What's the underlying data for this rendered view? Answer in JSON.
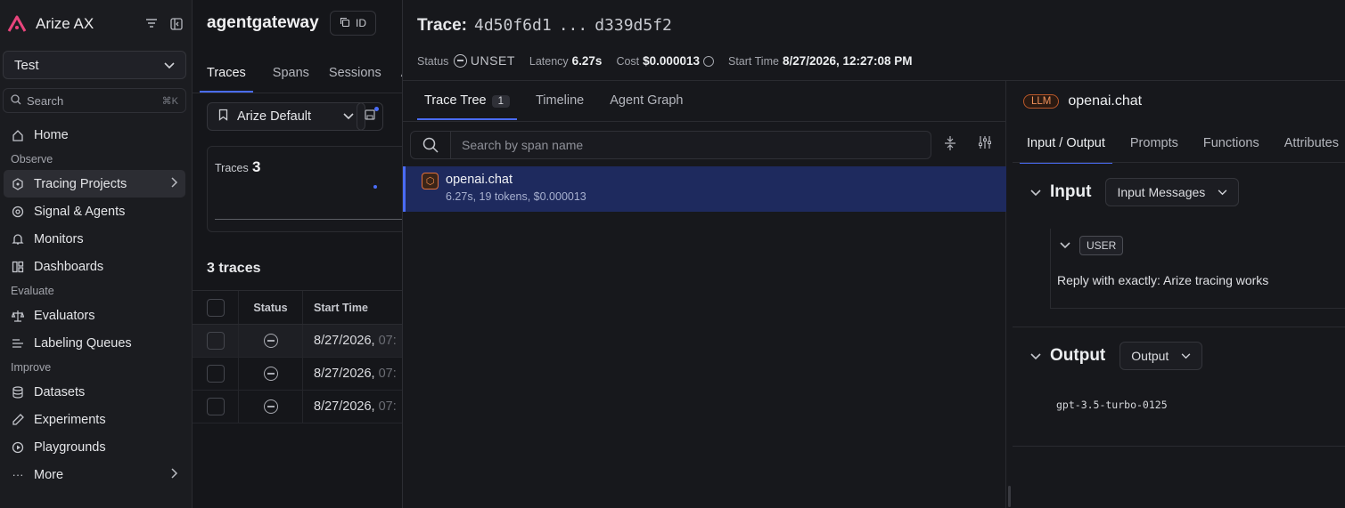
{
  "app": {
    "name": "Arize AX",
    "logo_icon": "arize-logo-icon",
    "brand_color": "#e8457c",
    "accent_color": "#4a6cf7"
  },
  "sidebar": {
    "space": "Test",
    "search_placeholder": "Search",
    "search_shortcut": "⌘K",
    "items": [
      {
        "type": "item",
        "label": "Home",
        "icon": "home-icon"
      },
      {
        "type": "section",
        "label": "Observe"
      },
      {
        "type": "item",
        "label": "Tracing Projects",
        "icon": "tracing-icon",
        "active": true,
        "chevron": true
      },
      {
        "type": "item",
        "label": "Signal & Agents",
        "icon": "signal-icon"
      },
      {
        "type": "item",
        "label": "Monitors",
        "icon": "bell-icon"
      },
      {
        "type": "item",
        "label": "Dashboards",
        "icon": "dashboard-icon"
      },
      {
        "type": "section",
        "label": "Evaluate"
      },
      {
        "type": "item",
        "label": "Evaluators",
        "icon": "scale-icon"
      },
      {
        "type": "item",
        "label": "Labeling Queues",
        "icon": "list-icon"
      },
      {
        "type": "section",
        "label": "Improve"
      },
      {
        "type": "item",
        "label": "Datasets",
        "icon": "database-icon"
      },
      {
        "type": "item",
        "label": "Experiments",
        "icon": "flask-icon"
      },
      {
        "type": "item",
        "label": "Playgrounds",
        "icon": "play-icon"
      },
      {
        "type": "item",
        "label": "More",
        "icon": "more-icon",
        "chevron": true
      }
    ]
  },
  "project": {
    "title": "agentgateway",
    "id_label": "ID",
    "tabs": [
      "Traces",
      "Spans",
      "Sessions",
      "A"
    ],
    "view": "Arize Default",
    "card_label": "Traces",
    "card_count": "3",
    "traces_count": "3 traces",
    "columns": [
      "Status",
      "Start Time"
    ],
    "rows": [
      {
        "start": "8/27/2026,",
        "tail": "07:"
      },
      {
        "start": "8/27/2026,",
        "tail": "07:"
      },
      {
        "start": "8/27/2026,",
        "tail": "07:"
      }
    ]
  },
  "trace": {
    "label": "Trace:",
    "id_start": "4d50f6d1",
    "ellipsis": "...",
    "id_end": "d339d5f2",
    "status_label": "Status",
    "status_value": "UNSET",
    "latency_label": "Latency",
    "latency_value": "6.27s",
    "cost_label": "Cost",
    "cost_value": "$0.000013",
    "start_label": "Start Time",
    "start_value": "8/27/2026, 12:27:08 PM"
  },
  "tree": {
    "tabs": [
      {
        "label": "Trace Tree",
        "badge": "1",
        "active": true
      },
      {
        "label": "Timeline"
      },
      {
        "label": "Agent Graph"
      }
    ],
    "search_placeholder": "Search by span name",
    "span": {
      "name": "openai.chat",
      "sub": "6.27s, 19 tokens, $0.000013",
      "kind_icon": "hexagon-icon"
    }
  },
  "detail": {
    "kind": "LLM",
    "title": "openai.chat",
    "tabs": [
      "Input / Output",
      "Prompts",
      "Functions",
      "Attributes"
    ],
    "input_title": "Input",
    "input_select": "Input Messages",
    "role": "USER",
    "message": "Reply with exactly: Arize tracing works",
    "output_title": "Output",
    "output_select": "Output",
    "output_value": "gpt-3.5-turbo-0125"
  }
}
